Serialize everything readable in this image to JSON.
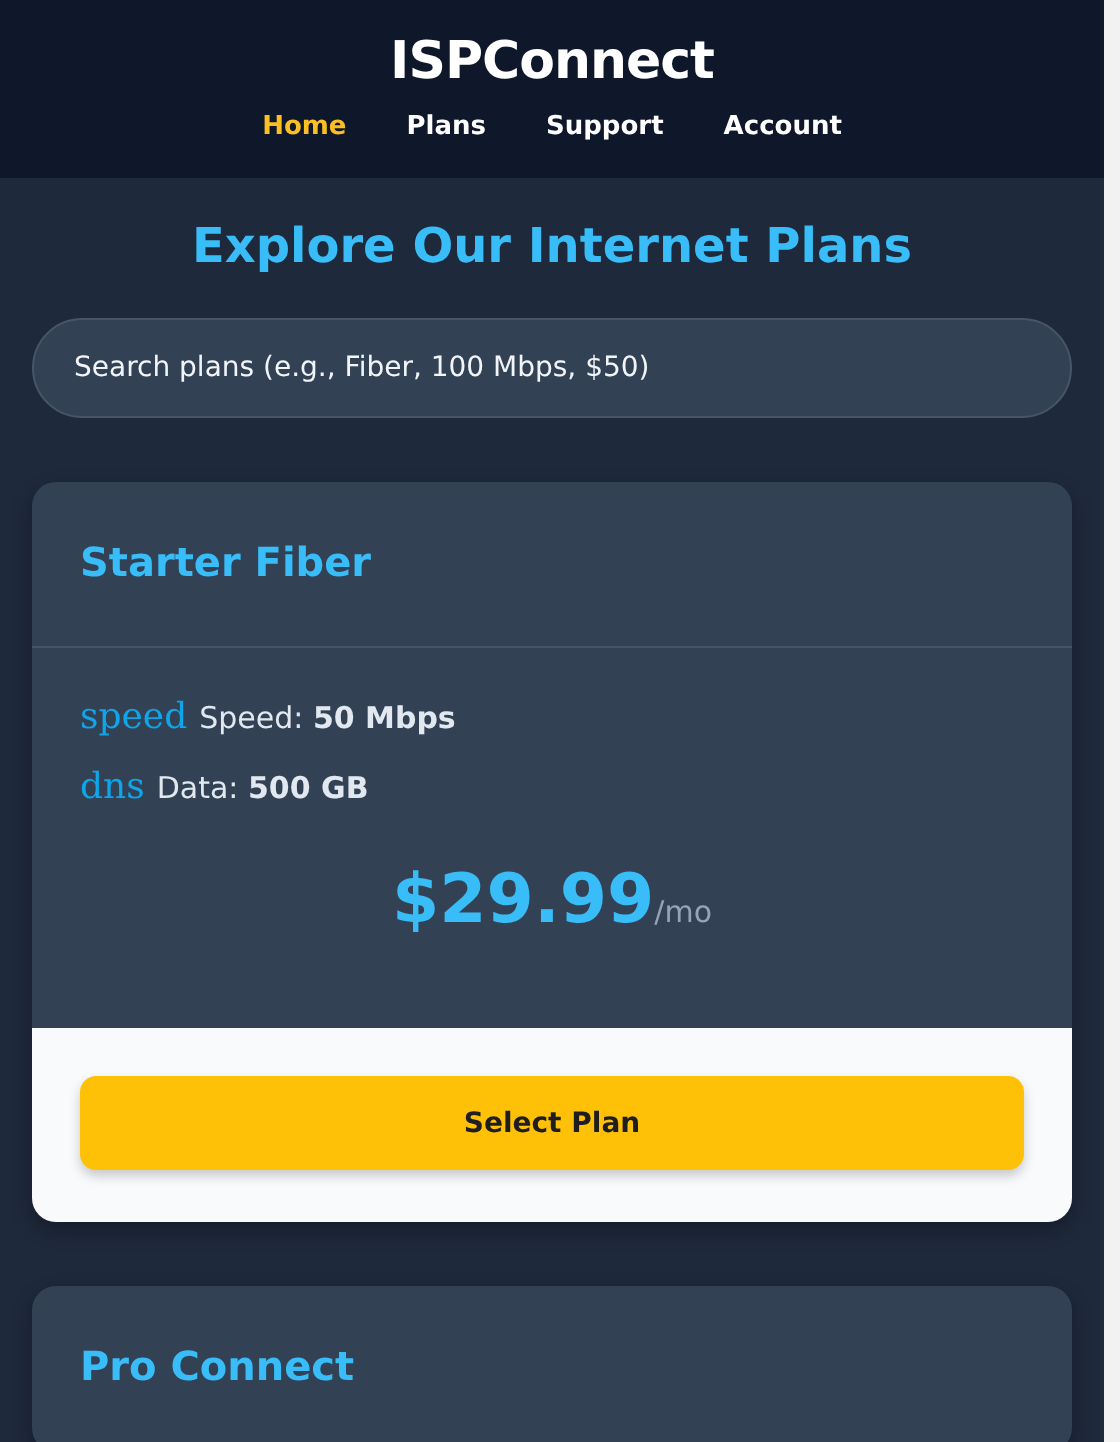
{
  "header": {
    "logo": "ISPConnect",
    "nav": [
      {
        "label": "Home",
        "selected": true
      },
      {
        "label": "Plans",
        "selected": false
      },
      {
        "label": "Support",
        "selected": false
      },
      {
        "label": "Account",
        "selected": false
      }
    ]
  },
  "page_title": "Explore Our Internet Plans",
  "search": {
    "placeholder": "Search plans (e.g., Fiber, 100 Mbps, $50)"
  },
  "plans": [
    {
      "name": "Starter Fiber",
      "features": [
        {
          "icon": "speed",
          "label": "Speed:",
          "value": "50 Mbps"
        },
        {
          "icon": "dns",
          "label": "Data:",
          "value": "500 GB"
        }
      ],
      "price": "$29.99",
      "period": "/mo",
      "button": "Select Plan"
    },
    {
      "name": "Pro Connect"
    }
  ]
}
